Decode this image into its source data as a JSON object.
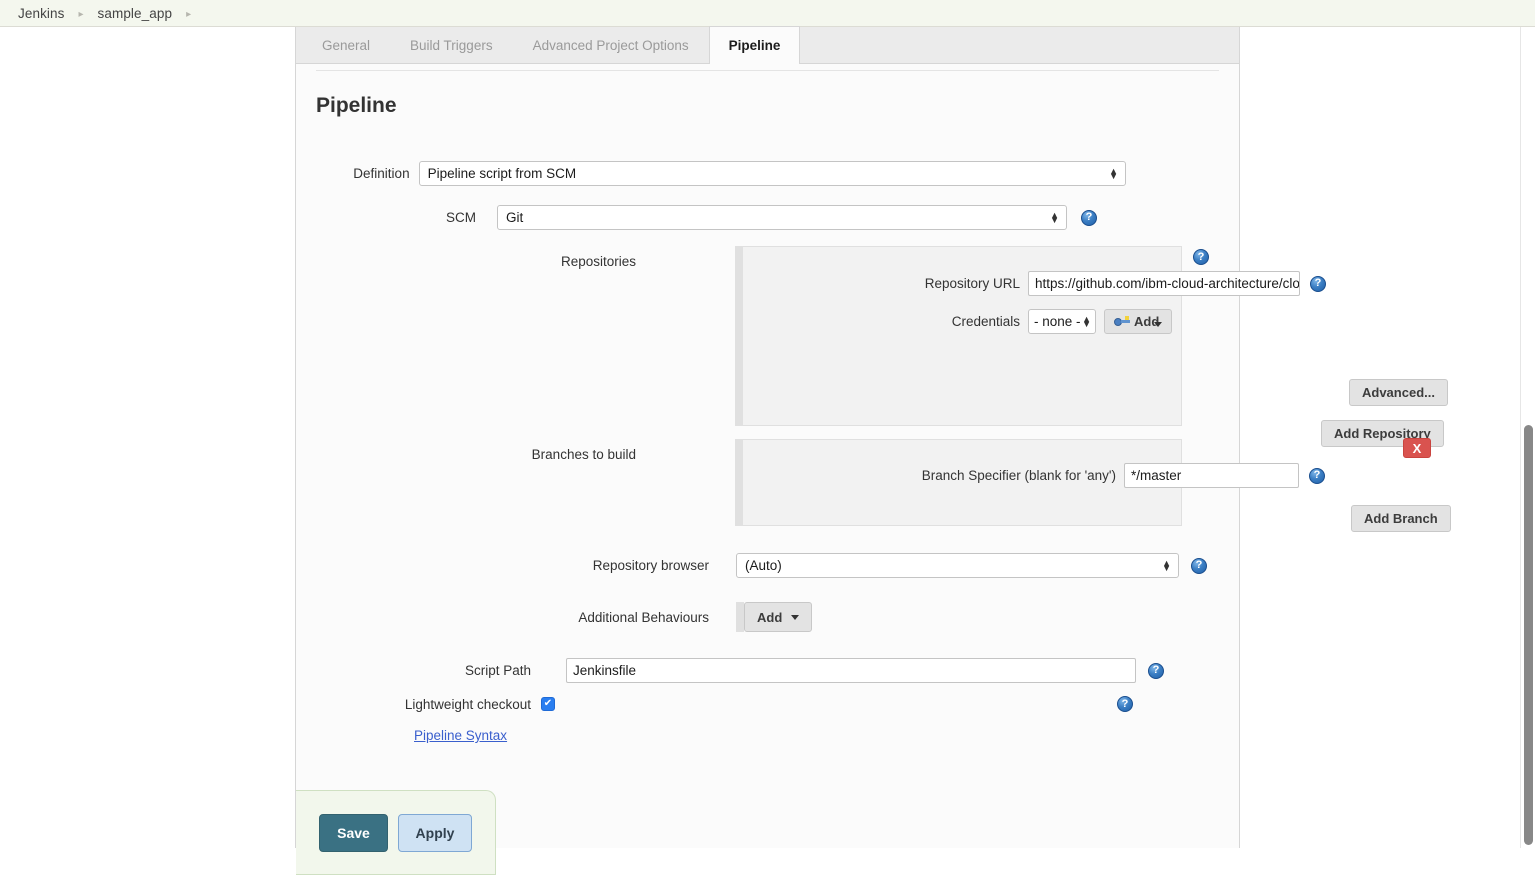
{
  "breadcrumb": {
    "items": [
      {
        "label": "Jenkins"
      },
      {
        "label": "sample_app"
      }
    ],
    "separator": "▸"
  },
  "tabs": [
    {
      "label": "General",
      "active": false
    },
    {
      "label": "Build Triggers",
      "active": false
    },
    {
      "label": "Advanced Project Options",
      "active": false
    },
    {
      "label": "Pipeline",
      "active": true
    }
  ],
  "page": {
    "title": "Pipeline"
  },
  "definition": {
    "label": "Definition",
    "value": "Pipeline script from SCM"
  },
  "scm": {
    "label": "SCM",
    "value": "Git"
  },
  "repositories": {
    "label": "Repositories",
    "url_label": "Repository URL",
    "url_value": "https://github.com/ibm-cloud-architecture/clou",
    "credentials_label": "Credentials",
    "credentials_value": "- none -",
    "credentials_add_label": "Add",
    "advanced_label": "Advanced...",
    "add_repository_label": "Add Repository"
  },
  "branches": {
    "label": "Branches to build",
    "delete_label": "X",
    "specifier_label": "Branch Specifier (blank for 'any')",
    "specifier_value": "*/master",
    "add_branch_label": "Add Branch"
  },
  "repo_browser": {
    "label": "Repository browser",
    "value": "(Auto)"
  },
  "additional_behaviours": {
    "label": "Additional Behaviours",
    "add_label": "Add"
  },
  "script_path": {
    "label": "Script Path",
    "value": "Jenkinsfile"
  },
  "lightweight": {
    "label": "Lightweight checkout",
    "checked": true,
    "check_glyph": "✔"
  },
  "pipeline_syntax": {
    "label": "Pipeline Syntax"
  },
  "footer": {
    "save_label": "Save",
    "apply_label": "Apply"
  },
  "help": {
    "glyph": "?"
  },
  "colors": {
    "save_button": "#3a7183",
    "apply_button": "#cfe2f3",
    "delete_button": "#d9534f",
    "checkbox": "#2a7ef0",
    "help_icon": "#3c7fc4",
    "link": "#3a5fcd",
    "footer_panel": "#f2f7ec",
    "breadcrumb_bar": "#f4f7ee"
  }
}
